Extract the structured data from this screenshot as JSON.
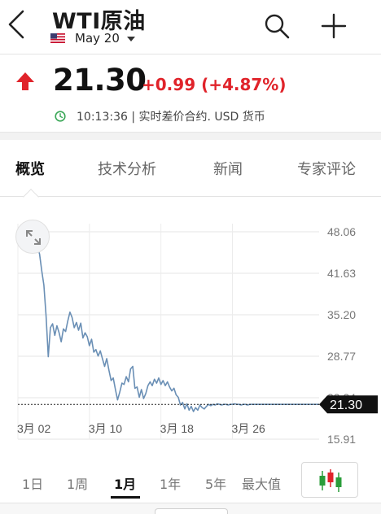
{
  "header": {
    "title": "WTI原油",
    "date": "May 20"
  },
  "quote": {
    "price": "21.30",
    "change": "+0.99 (+4.87%)",
    "time_info": "10:13:36 | 实时差价合约.  USD 货币",
    "up_color": "#e0232a"
  },
  "tabs": [
    {
      "label": "概览",
      "active": true
    },
    {
      "label": "技术分析",
      "active": false
    },
    {
      "label": "新闻",
      "active": false
    },
    {
      "label": "专家评论",
      "active": false
    }
  ],
  "chart_data": {
    "type": "line",
    "y_tick_labels": [
      "48.06",
      "41.63",
      "35.20",
      "28.77",
      "22.34",
      "15.91"
    ],
    "x_tick_labels": [
      "3月 02",
      "3月 10",
      "3月 18",
      "3月 26"
    ],
    "current_value_label": "21.30",
    "current_value": 21.3,
    "ylim": [
      15.91,
      48.06
    ],
    "grid": true,
    "line_color": "#6a8fb5",
    "x": [
      0,
      1,
      2,
      3,
      4,
      5,
      6,
      7,
      8,
      9,
      10,
      11,
      12,
      13,
      14,
      15,
      16,
      17,
      18,
      19,
      20,
      21,
      22,
      23,
      24,
      25,
      26,
      27,
      28,
      29,
      30,
      31,
      32,
      33,
      34,
      35,
      36,
      37,
      38,
      39,
      40,
      41,
      42,
      43,
      44,
      45,
      46,
      47,
      48,
      49,
      50,
      51,
      52,
      53,
      54,
      55,
      56,
      57,
      58,
      59,
      60,
      61,
      62,
      63,
      64,
      65,
      66,
      67,
      68,
      69,
      70,
      71,
      72,
      73,
      74,
      75,
      76,
      77,
      78,
      79,
      80,
      81,
      82,
      83,
      84,
      85,
      86,
      87,
      88,
      89,
      90,
      91,
      92,
      93,
      94,
      95,
      96,
      97,
      98,
      99,
      100,
      101,
      102,
      103,
      104,
      105,
      106,
      107,
      108,
      109,
      110,
      111,
      112,
      113,
      114,
      115,
      116,
      117,
      118,
      119,
      120,
      121,
      122,
      123,
      124,
      125,
      126,
      127,
      128,
      129,
      130,
      131,
      132,
      133,
      134,
      135,
      136,
      137,
      138,
      139
    ],
    "y": [
      47.2,
      46.8,
      47.6,
      46.5,
      47.4,
      46.9,
      47.3,
      46.0,
      46.4,
      45.8,
      44.6,
      42.0,
      39.8,
      35.0,
      28.7,
      33.2,
      33.8,
      32.0,
      33.5,
      32.4,
      31.0,
      33.0,
      32.6,
      34.2,
      35.6,
      34.8,
      33.2,
      34.0,
      32.8,
      33.9,
      31.6,
      32.4,
      31.8,
      30.4,
      31.4,
      29.4,
      29.8,
      28.8,
      29.6,
      28.4,
      27.2,
      28.4,
      26.6,
      25.0,
      25.4,
      23.6,
      22.0,
      23.2,
      24.6,
      24.4,
      25.6,
      24.8,
      26.8,
      27.2,
      23.8,
      24.0,
      22.4,
      23.6,
      22.2,
      23.0,
      24.2,
      24.8,
      24.2,
      25.2,
      24.6,
      25.4,
      24.4,
      25.0,
      24.2,
      24.8,
      24.0,
      23.4,
      23.8,
      22.8,
      22.4,
      21.2,
      21.6,
      20.6,
      21.4,
      20.4,
      21.0,
      20.2,
      20.8,
      20.4,
      21.2,
      20.8,
      20.6,
      21.0,
      21.3,
      21.1,
      21.3,
      21.2,
      21.4,
      21.3,
      21.2,
      21.3,
      21.3,
      21.2,
      21.3,
      21.3,
      21.4,
      21.3,
      21.3,
      21.2,
      21.3,
      21.3,
      21.2,
      21.3,
      21.3,
      21.3,
      21.3,
      21.3,
      21.3,
      21.3,
      21.3,
      21.3,
      21.3,
      21.3,
      21.3,
      21.3,
      21.3,
      21.3,
      21.3,
      21.3,
      21.3,
      21.3,
      21.3,
      21.3,
      21.3,
      21.3,
      21.3,
      21.3,
      21.3,
      21.3,
      21.3,
      21.3,
      21.3,
      21.3,
      21.3,
      21.3
    ]
  },
  "periods": [
    {
      "label": "1日",
      "active": false
    },
    {
      "label": "1周",
      "active": false
    },
    {
      "label": "1月",
      "active": true
    },
    {
      "label": "1年",
      "active": false
    },
    {
      "label": "5年",
      "active": false
    },
    {
      "label": "最大值",
      "active": false
    }
  ],
  "icons": {
    "back": "chevron-left-icon",
    "flag": "us-flag-icon",
    "dropdown": "caret-down-icon",
    "search": "search-icon",
    "add": "plus-icon",
    "up": "up-arrow-icon",
    "time": "clock-icon",
    "expand": "expand-icon",
    "chart_type": "candlestick-icon"
  }
}
